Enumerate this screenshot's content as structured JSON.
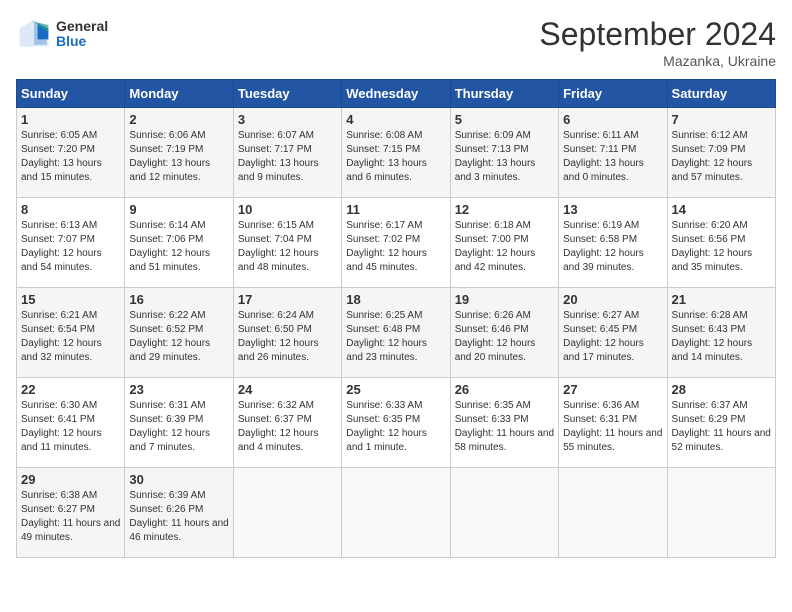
{
  "header": {
    "logo_general": "General",
    "logo_blue": "Blue",
    "month_title": "September 2024",
    "subtitle": "Mazanka, Ukraine"
  },
  "days_of_week": [
    "Sunday",
    "Monday",
    "Tuesday",
    "Wednesday",
    "Thursday",
    "Friday",
    "Saturday"
  ],
  "weeks": [
    [
      {
        "day": "1",
        "sunrise": "Sunrise: 6:05 AM",
        "sunset": "Sunset: 7:20 PM",
        "daylight": "Daylight: 13 hours and 15 minutes."
      },
      {
        "day": "2",
        "sunrise": "Sunrise: 6:06 AM",
        "sunset": "Sunset: 7:19 PM",
        "daylight": "Daylight: 13 hours and 12 minutes."
      },
      {
        "day": "3",
        "sunrise": "Sunrise: 6:07 AM",
        "sunset": "Sunset: 7:17 PM",
        "daylight": "Daylight: 13 hours and 9 minutes."
      },
      {
        "day": "4",
        "sunrise": "Sunrise: 6:08 AM",
        "sunset": "Sunset: 7:15 PM",
        "daylight": "Daylight: 13 hours and 6 minutes."
      },
      {
        "day": "5",
        "sunrise": "Sunrise: 6:09 AM",
        "sunset": "Sunset: 7:13 PM",
        "daylight": "Daylight: 13 hours and 3 minutes."
      },
      {
        "day": "6",
        "sunrise": "Sunrise: 6:11 AM",
        "sunset": "Sunset: 7:11 PM",
        "daylight": "Daylight: 13 hours and 0 minutes."
      },
      {
        "day": "7",
        "sunrise": "Sunrise: 6:12 AM",
        "sunset": "Sunset: 7:09 PM",
        "daylight": "Daylight: 12 hours and 57 minutes."
      }
    ],
    [
      {
        "day": "8",
        "sunrise": "Sunrise: 6:13 AM",
        "sunset": "Sunset: 7:07 PM",
        "daylight": "Daylight: 12 hours and 54 minutes."
      },
      {
        "day": "9",
        "sunrise": "Sunrise: 6:14 AM",
        "sunset": "Sunset: 7:06 PM",
        "daylight": "Daylight: 12 hours and 51 minutes."
      },
      {
        "day": "10",
        "sunrise": "Sunrise: 6:15 AM",
        "sunset": "Sunset: 7:04 PM",
        "daylight": "Daylight: 12 hours and 48 minutes."
      },
      {
        "day": "11",
        "sunrise": "Sunrise: 6:17 AM",
        "sunset": "Sunset: 7:02 PM",
        "daylight": "Daylight: 12 hours and 45 minutes."
      },
      {
        "day": "12",
        "sunrise": "Sunrise: 6:18 AM",
        "sunset": "Sunset: 7:00 PM",
        "daylight": "Daylight: 12 hours and 42 minutes."
      },
      {
        "day": "13",
        "sunrise": "Sunrise: 6:19 AM",
        "sunset": "Sunset: 6:58 PM",
        "daylight": "Daylight: 12 hours and 39 minutes."
      },
      {
        "day": "14",
        "sunrise": "Sunrise: 6:20 AM",
        "sunset": "Sunset: 6:56 PM",
        "daylight": "Daylight: 12 hours and 35 minutes."
      }
    ],
    [
      {
        "day": "15",
        "sunrise": "Sunrise: 6:21 AM",
        "sunset": "Sunset: 6:54 PM",
        "daylight": "Daylight: 12 hours and 32 minutes."
      },
      {
        "day": "16",
        "sunrise": "Sunrise: 6:22 AM",
        "sunset": "Sunset: 6:52 PM",
        "daylight": "Daylight: 12 hours and 29 minutes."
      },
      {
        "day": "17",
        "sunrise": "Sunrise: 6:24 AM",
        "sunset": "Sunset: 6:50 PM",
        "daylight": "Daylight: 12 hours and 26 minutes."
      },
      {
        "day": "18",
        "sunrise": "Sunrise: 6:25 AM",
        "sunset": "Sunset: 6:48 PM",
        "daylight": "Daylight: 12 hours and 23 minutes."
      },
      {
        "day": "19",
        "sunrise": "Sunrise: 6:26 AM",
        "sunset": "Sunset: 6:46 PM",
        "daylight": "Daylight: 12 hours and 20 minutes."
      },
      {
        "day": "20",
        "sunrise": "Sunrise: 6:27 AM",
        "sunset": "Sunset: 6:45 PM",
        "daylight": "Daylight: 12 hours and 17 minutes."
      },
      {
        "day": "21",
        "sunrise": "Sunrise: 6:28 AM",
        "sunset": "Sunset: 6:43 PM",
        "daylight": "Daylight: 12 hours and 14 minutes."
      }
    ],
    [
      {
        "day": "22",
        "sunrise": "Sunrise: 6:30 AM",
        "sunset": "Sunset: 6:41 PM",
        "daylight": "Daylight: 12 hours and 11 minutes."
      },
      {
        "day": "23",
        "sunrise": "Sunrise: 6:31 AM",
        "sunset": "Sunset: 6:39 PM",
        "daylight": "Daylight: 12 hours and 7 minutes."
      },
      {
        "day": "24",
        "sunrise": "Sunrise: 6:32 AM",
        "sunset": "Sunset: 6:37 PM",
        "daylight": "Daylight: 12 hours and 4 minutes."
      },
      {
        "day": "25",
        "sunrise": "Sunrise: 6:33 AM",
        "sunset": "Sunset: 6:35 PM",
        "daylight": "Daylight: 12 hours and 1 minute."
      },
      {
        "day": "26",
        "sunrise": "Sunrise: 6:35 AM",
        "sunset": "Sunset: 6:33 PM",
        "daylight": "Daylight: 11 hours and 58 minutes."
      },
      {
        "day": "27",
        "sunrise": "Sunrise: 6:36 AM",
        "sunset": "Sunset: 6:31 PM",
        "daylight": "Daylight: 11 hours and 55 minutes."
      },
      {
        "day": "28",
        "sunrise": "Sunrise: 6:37 AM",
        "sunset": "Sunset: 6:29 PM",
        "daylight": "Daylight: 11 hours and 52 minutes."
      }
    ],
    [
      {
        "day": "29",
        "sunrise": "Sunrise: 6:38 AM",
        "sunset": "Sunset: 6:27 PM",
        "daylight": "Daylight: 11 hours and 49 minutes."
      },
      {
        "day": "30",
        "sunrise": "Sunrise: 6:39 AM",
        "sunset": "Sunset: 6:26 PM",
        "daylight": "Daylight: 11 hours and 46 minutes."
      },
      null,
      null,
      null,
      null,
      null
    ]
  ]
}
